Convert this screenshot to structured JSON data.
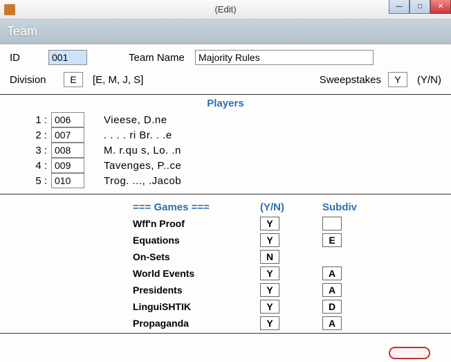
{
  "window": {
    "title": "(Edit)"
  },
  "banner": "Team",
  "fields": {
    "id_label": "ID",
    "id_value": "001",
    "teamname_label": "Team Name",
    "teamname_value": "Majority Rules",
    "division_label": "Division",
    "division_value": "E",
    "division_hint": "[E, M, J, S]",
    "sweep_label": "Sweepstakes",
    "sweep_value": "Y",
    "sweep_hint": "(Y/N)"
  },
  "players_heading": "Players",
  "players": [
    {
      "n": "1 :",
      "id": "006",
      "name": "Vieese, D.ne"
    },
    {
      "n": "2 :",
      "id": "007",
      "name": ". .  . . ri  Br. . .e"
    },
    {
      "n": "3 :",
      "id": "008",
      "name": "M. r.qu s, Lo. .n"
    },
    {
      "n": "4 :",
      "id": "009",
      "name": "Tavenges, P..ce"
    },
    {
      "n": "5 :",
      "id": "010",
      "name": "Trog. ..., .Jacob"
    }
  ],
  "games": {
    "head_games": "===  Games  ===",
    "head_yn": "(Y/N)",
    "head_subdiv": "Subdiv",
    "rows": [
      {
        "name": "Wff'n Proof",
        "yn": "Y",
        "sub": ""
      },
      {
        "name": "Equations",
        "yn": "Y",
        "sub": "E"
      },
      {
        "name": "On-Sets",
        "yn": "N",
        "sub": ""
      },
      {
        "name": "World Events",
        "yn": "Y",
        "sub": "A"
      },
      {
        "name": "Presidents",
        "yn": "Y",
        "sub": "A"
      },
      {
        "name": "LinguiSHTIK",
        "yn": "Y",
        "sub": "D"
      },
      {
        "name": "Propaganda",
        "yn": "Y",
        "sub": "A"
      }
    ]
  }
}
